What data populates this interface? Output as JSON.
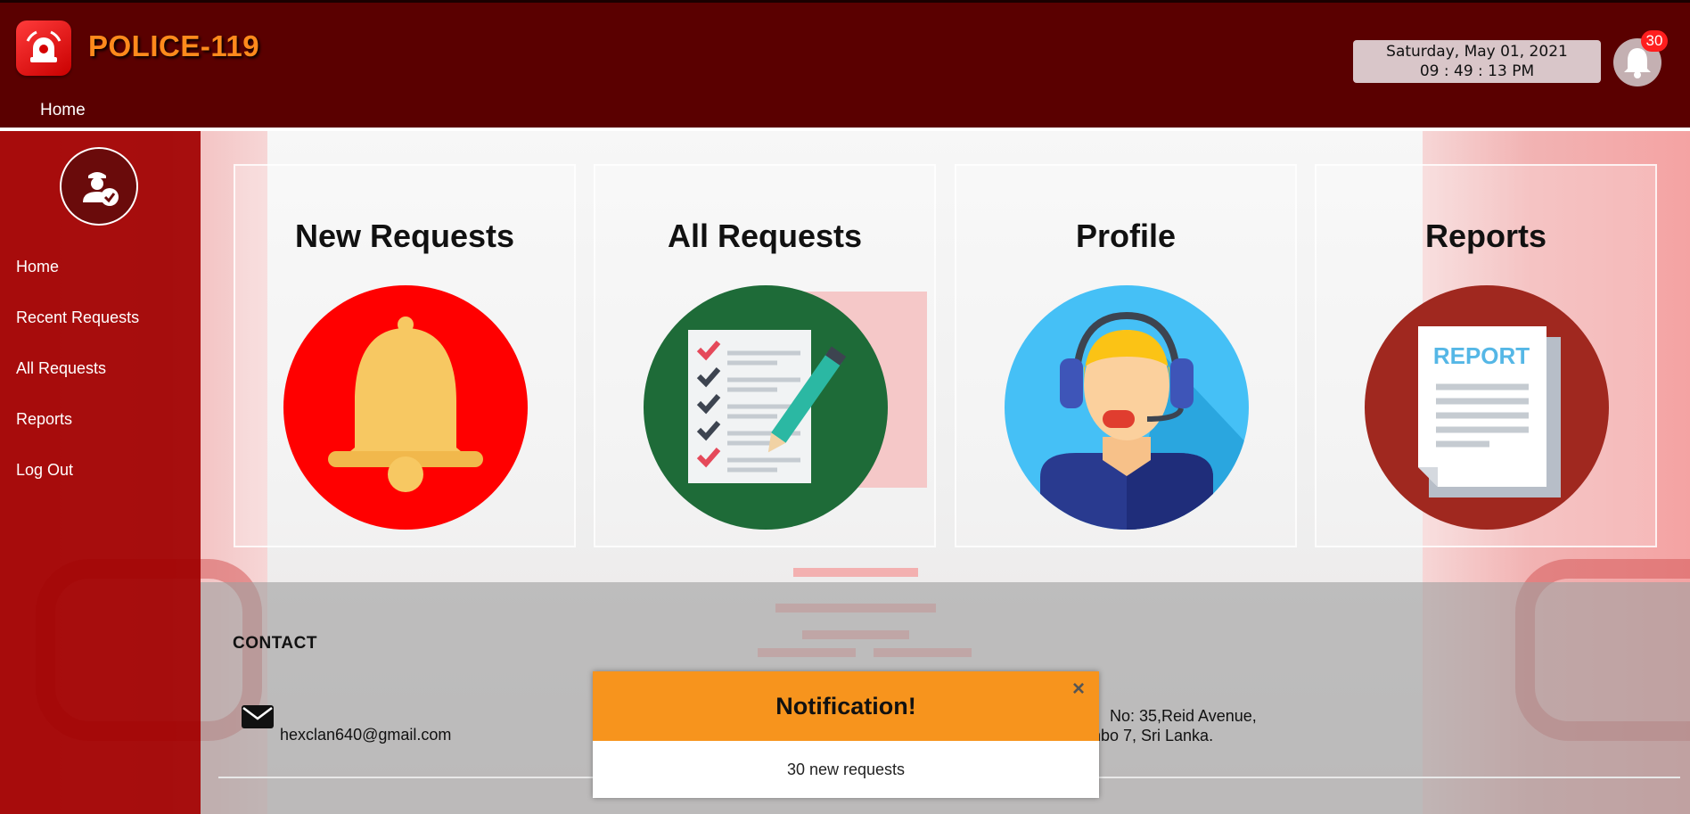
{
  "app": {
    "brand": "POLICE-119"
  },
  "header": {
    "nav_home": "Home",
    "date": "Saturday, May 01, 2021",
    "time": "09 : 49 : 13 PM",
    "notification_count": "30"
  },
  "sidebar": {
    "items": [
      {
        "label": "Home"
      },
      {
        "label": "Recent Requests"
      },
      {
        "label": "All Requests"
      },
      {
        "label": "Reports"
      },
      {
        "label": "Log Out"
      }
    ]
  },
  "cards": [
    {
      "title": "New Requests",
      "icon": "bell-icon",
      "color": "#ff0000"
    },
    {
      "title": "All Requests",
      "icon": "checklist-icon",
      "color": "#1e6b38"
    },
    {
      "title": "Profile",
      "icon": "operator-headset-icon",
      "color": "#45c0f6"
    },
    {
      "title": "Reports",
      "icon": "report-document-icon",
      "color": "#a0281f"
    }
  ],
  "report_icon_text": "REPORT",
  "contact": {
    "title": "CONTACT",
    "email": "hexclan640@gmail.com",
    "address_line1": "No: 35,Reid Avenue,",
    "address_line2": "mbo 7, Sri Lanka."
  },
  "notification": {
    "title": "Notification!",
    "close": "×",
    "message": "30 new requests"
  },
  "colors": {
    "header_bg": "#5a0000",
    "brand_text": "#ff8a1c",
    "sidebar_bg": "#a00000",
    "notification_header": "#f7941d",
    "badge": "#ff1e1e"
  }
}
